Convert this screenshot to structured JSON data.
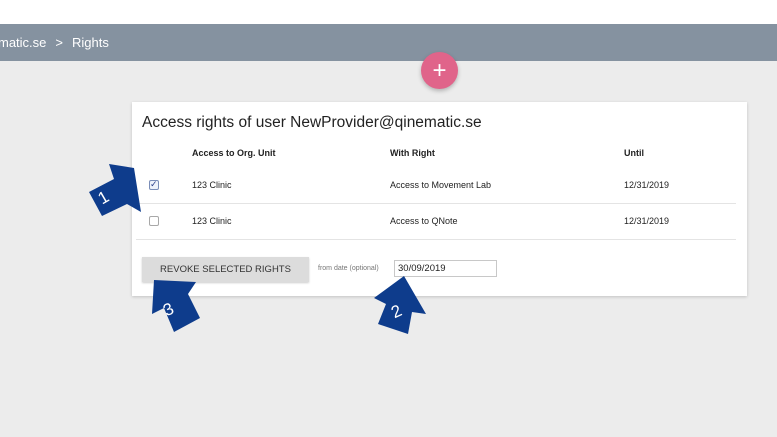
{
  "breadcrumb": {
    "domain": "matic.se",
    "separator": ">",
    "current": "Rights"
  },
  "fab": {
    "icon": "plus-icon",
    "label": "+"
  },
  "card": {
    "title": "Access rights of user NewProvider@qinematic.se",
    "columns": {
      "org_unit": "Access to Org. Unit",
      "right": "With Right",
      "until": "Until"
    },
    "rows": [
      {
        "checked": true,
        "org_unit": "123 Clinic",
        "right": "Access to Movement Lab",
        "until": "12/31/2019"
      },
      {
        "checked": false,
        "org_unit": "123 Clinic",
        "right": "Access to QNote",
        "until": "12/31/2019"
      }
    ],
    "revoke_button": "REVOKE SELECTED RIGHTS",
    "from_date_label": "from date (optional)",
    "from_date_value": "30/09/2019"
  },
  "annotations": {
    "marker_1": "1",
    "marker_2": "2",
    "marker_3": "3",
    "color": "#0e3c8c"
  },
  "colors": {
    "topbar": "#8592a0",
    "fab": "#e0648a",
    "workspace": "#ececec"
  }
}
